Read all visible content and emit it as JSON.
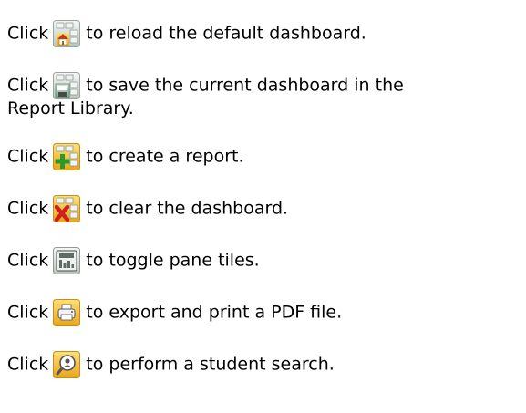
{
  "lines": [
    {
      "click": "Click",
      "icon": "dashboard-home-icon",
      "text": "to reload the default dashboard."
    },
    {
      "click": "Click",
      "icon": "dashboard-save-icon",
      "text": "to save the current dashboard in the",
      "text_cont": "Report Library."
    },
    {
      "click": "Click",
      "icon": "dashboard-add-icon",
      "text": "to create a report."
    },
    {
      "click": "Click",
      "icon": "dashboard-clear-icon",
      "text": "to clear the dashboard."
    },
    {
      "click": "Click",
      "icon": "toggle-tiles-icon",
      "text": "to toggle pane tiles."
    },
    {
      "click": "Click",
      "icon": "print-icon",
      "text": "to export and print a PDF file."
    },
    {
      "click": "Click",
      "icon": "student-search-icon",
      "text": "to perform a student search."
    }
  ],
  "colors": {
    "text": "#000000",
    "icon_grid_fill": "#f1f4f2",
    "icon_grid_stroke": "#8e9c93",
    "gold_top": "#ffd45c",
    "gold_bottom": "#e6a51b",
    "gray_top": "#f4f6f5",
    "gray_bottom": "#bac4bd",
    "home_red": "#c43420",
    "plus_green": "#2c9a2a",
    "x_red": "#d21e1e"
  }
}
